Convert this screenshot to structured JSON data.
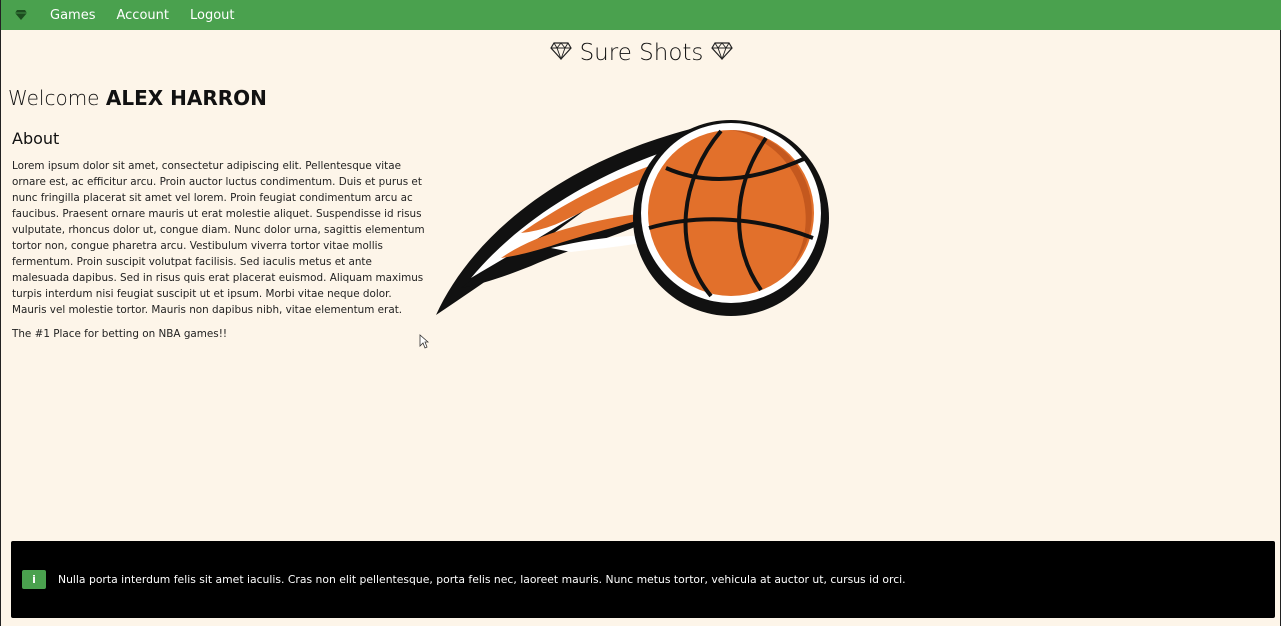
{
  "nav": {
    "brand_icon": "gem-icon",
    "links": [
      "Games",
      "Account",
      "Logout"
    ]
  },
  "header": {
    "title": "Sure Shots",
    "title_icon": "gem-icon"
  },
  "welcome": {
    "prefix": "Welcome",
    "name": "ALEX HARRON"
  },
  "about": {
    "heading": "About",
    "body": "Lorem ipsum dolor sit amet, consectetur adipiscing elit. Pellentesque vitae ornare est, ac efficitur arcu. Proin auctor luctus condimentum. Duis et purus et nunc fringilla placerat sit amet vel lorem. Proin feugiat condimentum arcu ac faucibus. Praesent ornare mauris ut erat molestie aliquet. Suspendisse id risus vulputate, rhoncus dolor ut, congue diam. Nunc dolor urna, sagittis elementum tortor non, congue pharetra arcu. Vestibulum viverra tortor vitae mollis fermentum. Proin suscipit volutpat facilisis. Sed iaculis metus et ante malesuada dapibus. Sed in risus quis erat placerat euismod. Aliquam maximus turpis interdum nisi feugiat suscipit ut et ipsum. Morbi vitae neque dolor. Mauris vel molestie tortor. Mauris non dapibus nibh, vitae elementum erat.",
    "tagline": "The #1 Place for betting on NBA games!!"
  },
  "logo": {
    "icon": "basketball-flame-logo"
  },
  "toast": {
    "icon": "info-icon",
    "icon_glyph": "i",
    "message": "Nulla porta interdum felis sit amet iaculis. Cras non elit pellentesque, porta felis nec, laoreet mauris. Nunc metus tortor, vehicula at auctor ut, cursus id orci."
  },
  "colors": {
    "navbar": "#4aa14e",
    "background": "#fdf5e9",
    "toast_bg": "#000000",
    "ball": "#e2702b"
  }
}
